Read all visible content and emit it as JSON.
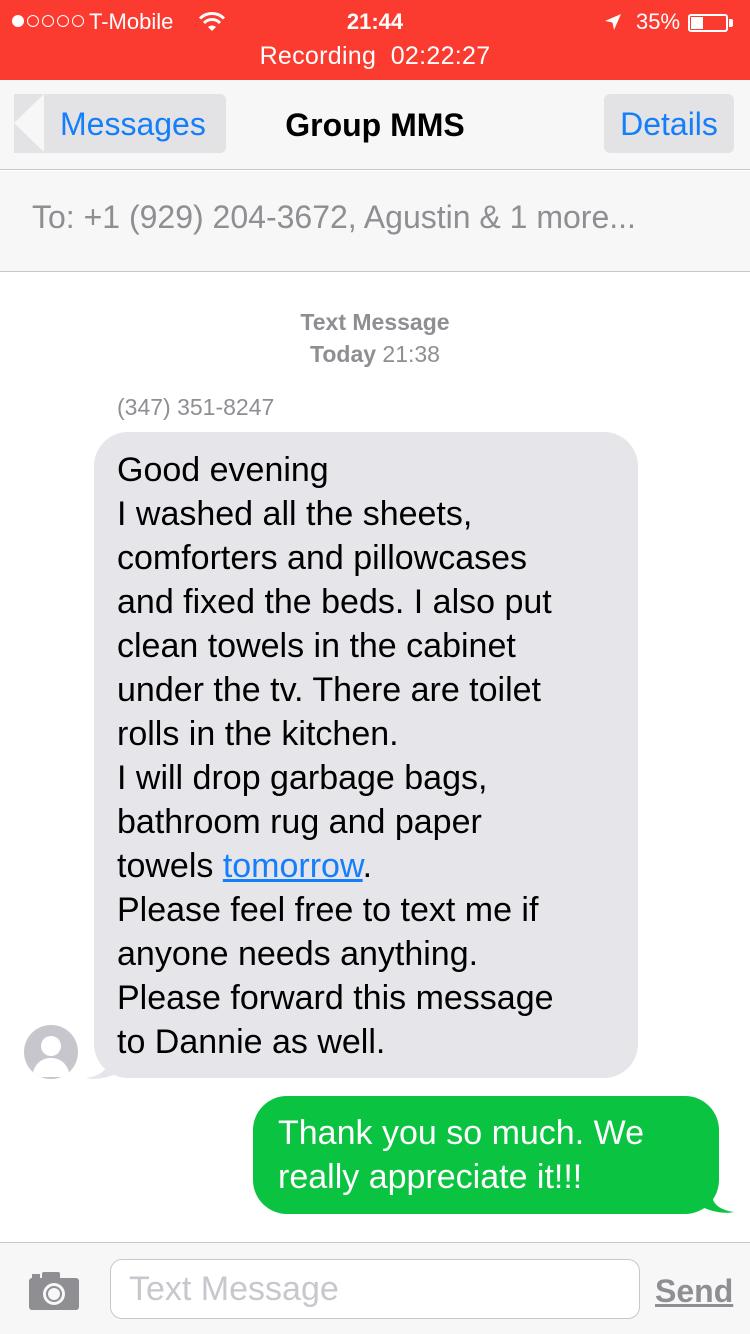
{
  "status_bar": {
    "carrier": "T-Mobile",
    "time": "21:44",
    "battery": "35%",
    "recording_label": "Recording",
    "recording_time": "02:22:27",
    "background_color": "#fb3b30",
    "signal_bars_filled": 1,
    "signal_bars_total": 5
  },
  "nav": {
    "back_label": "Messages",
    "title": "Group MMS",
    "details_label": "Details"
  },
  "to_bar": {
    "text": "To: +1 (929) 204-3672, Agustin & 1 more..."
  },
  "conversation": {
    "service_label": "Text Message",
    "day_label": "Today",
    "time_label": "21:38",
    "incoming": {
      "sender": "(347) 351-8247",
      "lines": [
        "Good evening",
        "I washed all the sheets,",
        "comforters and pillowcases",
        "and fixed the beds. I also put",
        "clean towels in the cabinet",
        "under the tv. There are toilet",
        "rolls in the kitchen.",
        "I will drop garbage bags,",
        "bathroom rug and paper",
        "Please feel free to text me if",
        "anyone needs anything.",
        "Please forward this message",
        "to Dannie as well."
      ],
      "link_line_prefix": "towels ",
      "link_text": "tomorrow",
      "link_line_suffix": ".",
      "bubble_color": "#e5e5ea"
    },
    "outgoing": {
      "lines": [
        "Thank you so much. We",
        "really appreciate it!!!"
      ],
      "bubble_color": "#0ac341"
    }
  },
  "input_bar": {
    "camera_icon": "camera-icon",
    "placeholder": "Text Message",
    "value": "",
    "send_label": "Send"
  },
  "colors": {
    "accent": "#147efb",
    "secondary_text": "#8e8e93"
  }
}
